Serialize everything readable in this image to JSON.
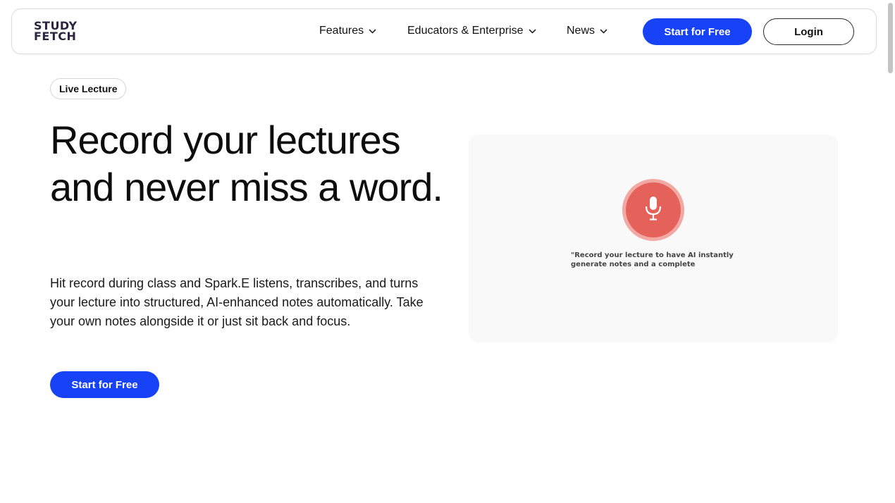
{
  "nav": {
    "logo_line1": "STUDY",
    "logo_line2": "FETCH",
    "items": [
      {
        "label": "Features"
      },
      {
        "label": "Educators & Enterprise"
      },
      {
        "label": "News"
      }
    ],
    "start_button": "Start for Free",
    "login_button": "Login"
  },
  "hero": {
    "badge": "Live Lecture",
    "headline": "Record your lectures and never miss a word.",
    "description": "Hit record during class and Spark.E listens, transcribes, and turns your lecture into structured, AI-enhanced notes automatically. Take your own notes alongside it or just sit back and focus.",
    "cta": "Start for Free"
  },
  "demo": {
    "icon": "microphone-icon",
    "caption": "\"Record your lecture to have AI instantly generate notes and a complete"
  },
  "colors": {
    "accent": "#1842f5",
    "mic_red": "#e5625b",
    "mic_ring": "#f2a8a3",
    "card_bg": "#f9f9f9"
  }
}
